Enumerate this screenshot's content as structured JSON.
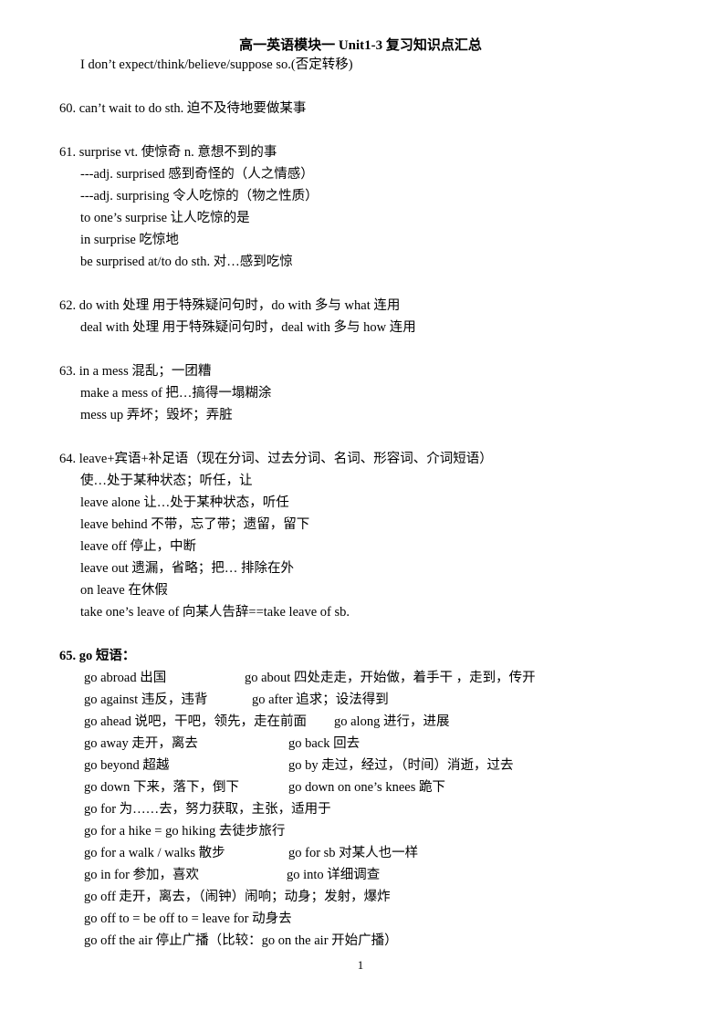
{
  "document": {
    "title": "高一英语模块一 Unit1-3 复习知识点汇总",
    "page_number": "1",
    "lines": [
      {
        "text": "I don’t expect/think/believe/suppose so.(否定转移)"
      },
      {
        "text": "60. can’t wait to do sth.  迫不及待地要做某事"
      },
      {
        "text": "61. surprise vt.  使惊奇    n.  意想不到的事"
      },
      {
        "text": "---adj. surprised  感到奇怪的（人之情感）"
      },
      {
        "text": "---adj. surprising   令人吃惊的（物之性质）"
      },
      {
        "text": "to one’s surprise 让人吃惊的是"
      },
      {
        "text": "in surprise  吃惊地"
      },
      {
        "text": "be surprised at/to do sth.  对…感到吃惊"
      },
      {
        "text": "62. do with  处理  用于特殊疑问句时，do with 多与 what 连用"
      },
      {
        "text": "deal with  处理  用于特殊疑问句时，deal with 多与 how 连用"
      },
      {
        "text": "63. in a mess  混乱；一团糟"
      },
      {
        "text": "make a mess of  把…搞得一塌糊涂"
      },
      {
        "text": "mess up 弄坏；毁坏；弄脏"
      },
      {
        "text": "64. leave+宾语+补足语（现在分词、过去分词、名词、形容词、介词短语）"
      },
      {
        "text": "使…处于某种状态；听任，让"
      },
      {
        "text": "leave alone 让…处于某种状态，听任"
      },
      {
        "text": "leave behind  不带，忘了带；遗留，留下"
      },
      {
        "text": "leave off  停止，中断"
      },
      {
        "text": "leave out  遗漏，省略；把… 排除在外"
      },
      {
        "text": "on leave  在休假"
      },
      {
        "text": "take one’s leave of 向某人告辞==take leave of sb."
      },
      {
        "text": "65. go 短语："
      }
    ],
    "go_phrases": [
      {
        "left": "go abroad  出国",
        "right": "go about  四处走走，开始做，着手干 ，走到，传开"
      },
      {
        "left": "go against  违反，违背",
        "right": "go after 追求；设法得到"
      },
      {
        "left": "go ahead  说吧，干吧，领先，走在前面",
        "right": "go along 进行，进展"
      },
      {
        "left": "go away  走开，离去",
        "right": "go back  回去"
      },
      {
        "left": "go beyond  超越",
        "right": "go by  走过，经过，（时间）消逝，过去"
      },
      {
        "left": "go down  下来，落下，倒下",
        "right": "go down on one’s knees  跪下"
      },
      {
        "left": "go for  为……去，努力获取，主张，适用于",
        "right": ""
      },
      {
        "left": "go for a hike = go hiking  去徒步旅行",
        "right": ""
      },
      {
        "left": "go for a walk / walks  散步",
        "right": "go for sb  对某人也一样"
      },
      {
        "left": "go in for  参加，喜欢",
        "right": "go into  详细调查"
      },
      {
        "left": "go off  走开，离去，（闹钟）闹响；动身；发射，爆炸",
        "right": ""
      },
      {
        "left": "go off to = be off to = leave for  动身去",
        "right": ""
      },
      {
        "left": "go off the air  停止广播（比较：go on the air  开始广播）",
        "right": ""
      }
    ]
  }
}
